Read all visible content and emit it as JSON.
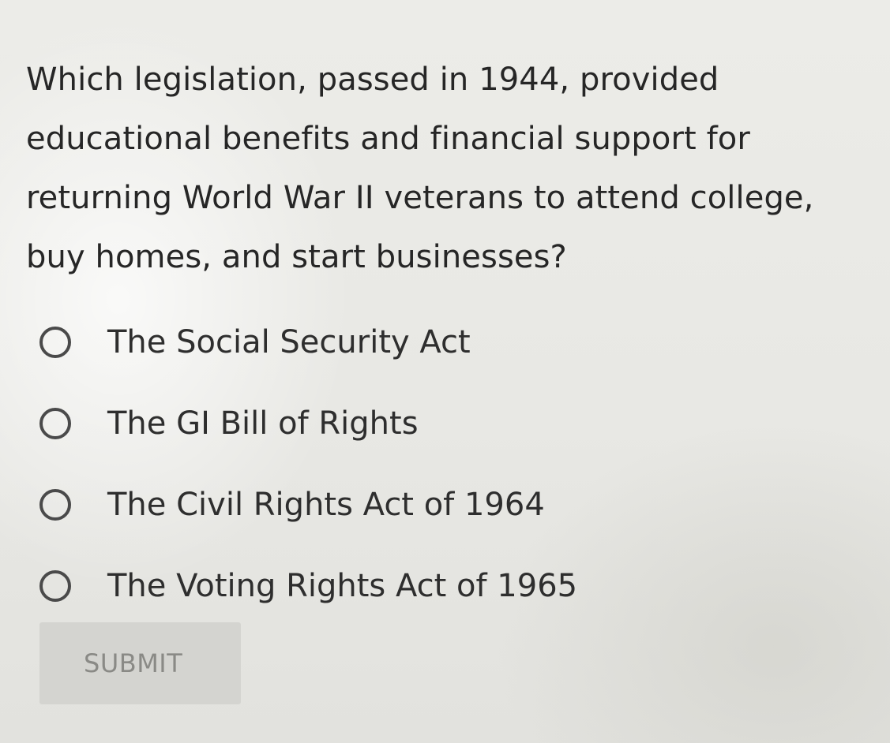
{
  "question": {
    "text": "Which legislation, passed in 1944, provided educational benefits and financial support for returning World War II veterans to attend college, buy homes, and start businesses?"
  },
  "options": [
    {
      "label": "The Social Security Act",
      "selected": false
    },
    {
      "label": "The GI Bill of Rights",
      "selected": false
    },
    {
      "label": "The Civil Rights Act of 1964",
      "selected": false
    },
    {
      "label": "The Voting Rights Act of 1965",
      "selected": false
    }
  ],
  "submit": {
    "label": "SUBMIT",
    "enabled": false
  },
  "colors": {
    "background": "#e8e8e4",
    "text": "#262626",
    "radio_border": "#4a4a4a",
    "submit_bg": "#d4d4d0",
    "submit_text": "#8a8a86"
  }
}
